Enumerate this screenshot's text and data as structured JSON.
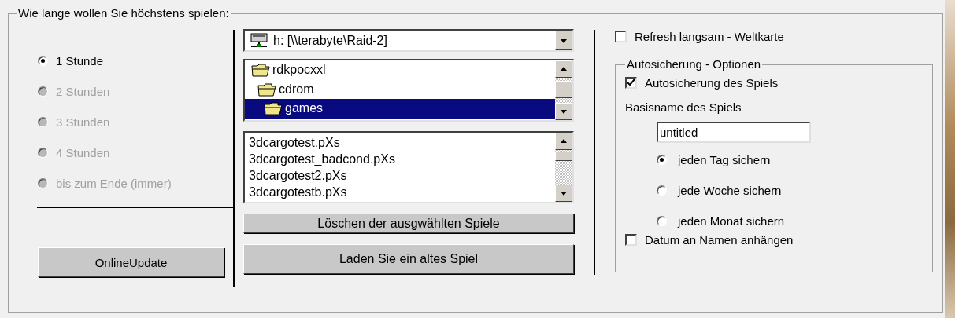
{
  "group_title": "Wie lange wollen Sie höchstens spielen:",
  "durations": [
    {
      "label": "1 Stunde",
      "selected": true,
      "disabled": false
    },
    {
      "label": "2 Stunden",
      "selected": false,
      "disabled": true
    },
    {
      "label": "3 Stunden",
      "selected": false,
      "disabled": true
    },
    {
      "label": "4 Stunden",
      "selected": false,
      "disabled": true
    },
    {
      "label": "bis zum Ende (immer)",
      "selected": false,
      "disabled": true
    }
  ],
  "online_update_button": "OnlineUpdate",
  "drive_select": {
    "value": "h: [\\\\terabyte\\Raid-2]"
  },
  "folders": [
    {
      "label": "rdkpocxxl",
      "selected": false,
      "children": [
        {
          "label": "cdrom",
          "selected": false,
          "children": [
            {
              "label": "games",
              "selected": true
            }
          ]
        }
      ]
    }
  ],
  "files": [
    {
      "label": "3dcargotest.pXs",
      "selected": false
    },
    {
      "label": "3dcargotest_badcond.pXs",
      "selected": false
    },
    {
      "label": "3dcargotest2.pXs",
      "selected": false
    },
    {
      "label": "3dcargotestb.pXs",
      "selected": false
    }
  ],
  "delete_button": "Löschen der ausgwählten Spiele",
  "load_button": "Laden Sie ein altes Spiel",
  "refresh_checkbox": {
    "label": "Refresh langsam - Weltkarte",
    "checked": false
  },
  "autosave": {
    "title": "Autosicherung - Optionen",
    "enable_checkbox": {
      "label": "Autosicherung des Spiels",
      "checked": true
    },
    "basename_label": "Basisname des Spiels",
    "basename_field": {
      "value": "untitled"
    },
    "intervals": [
      {
        "label": "jeden Tag sichern",
        "selected": true
      },
      {
        "label": "jede Woche sichern",
        "selected": false
      },
      {
        "label": "jeden Monat sichern",
        "selected": false
      }
    ],
    "date_checkbox": {
      "label": "Datum an Namen anhängen",
      "checked": false
    }
  }
}
